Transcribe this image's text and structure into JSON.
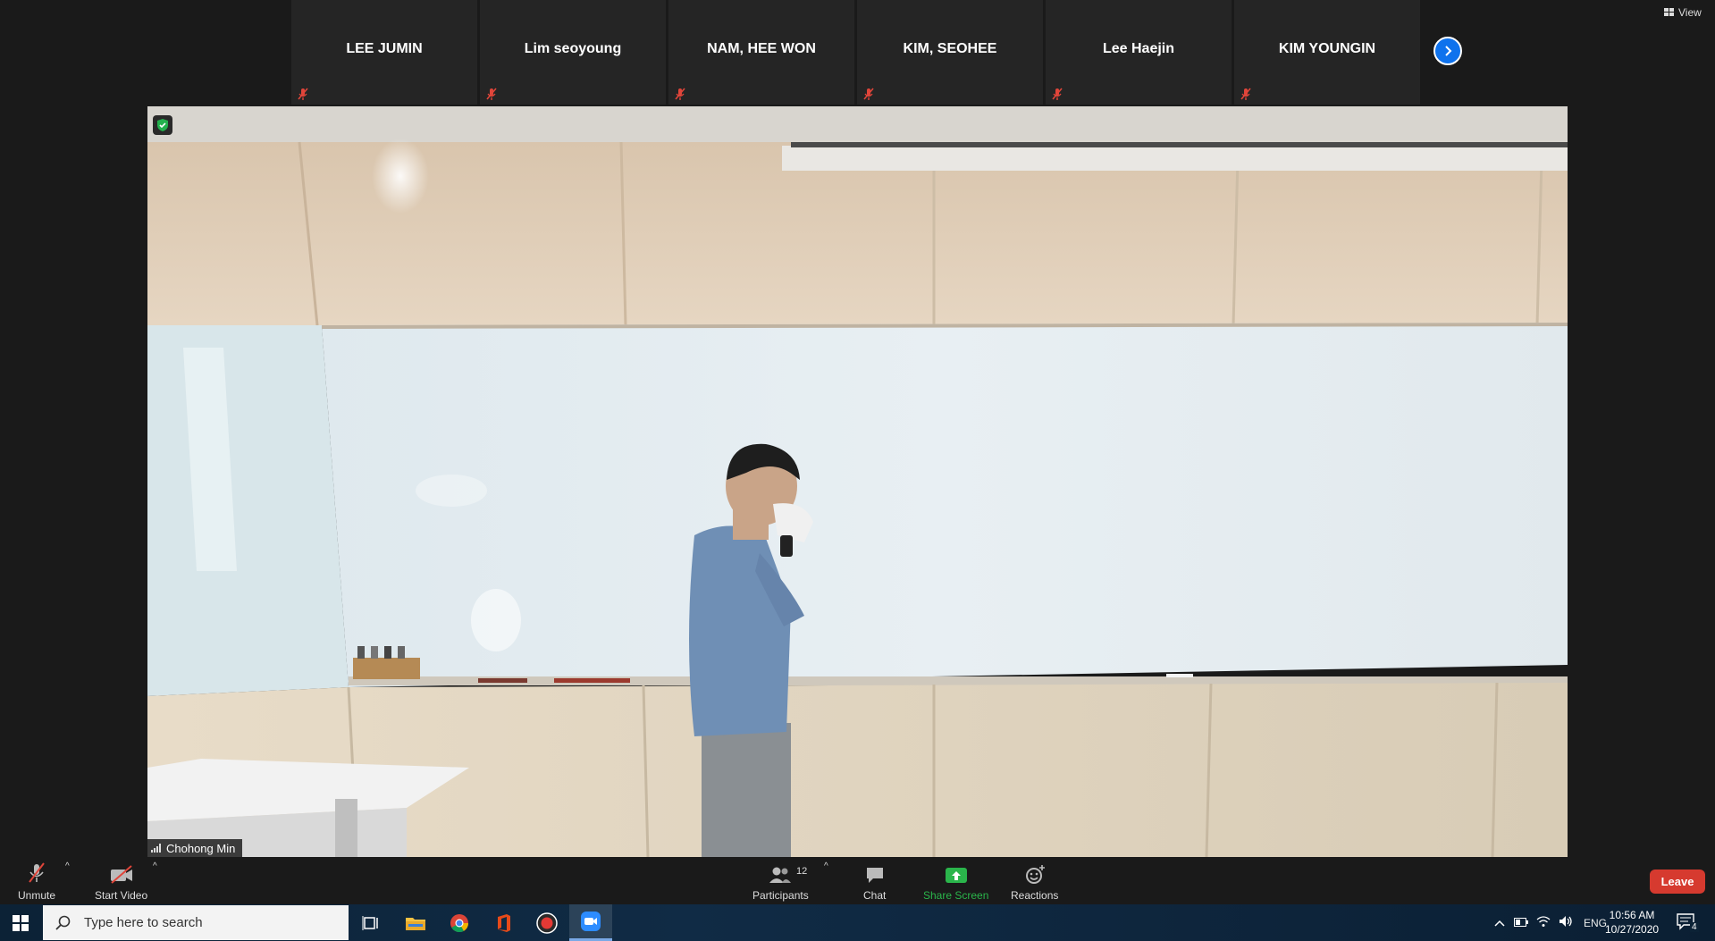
{
  "colors": {
    "background": "#1a1a1a",
    "tile": "#252525",
    "accent_blue": "#0e72ed",
    "share_green": "#2ab54b",
    "leave_red": "#d63a2f",
    "muted_red": "#e0453a"
  },
  "top_strip": {
    "participants": [
      {
        "name": "LEE JUMIN",
        "muted": true
      },
      {
        "name": "Lim seoyoung",
        "muted": true
      },
      {
        "name": "NAM, HEE WON",
        "muted": true
      },
      {
        "name": "KIM, SEOHEE",
        "muted": true
      },
      {
        "name": "Lee Haejin",
        "muted": true
      },
      {
        "name": "KIM YOUNGIN",
        "muted": true
      }
    ],
    "next_icon": "chevron-right-icon",
    "view_label": "View"
  },
  "main_video": {
    "speaker_name": "Chohong Min",
    "security_icon": "shield-check-icon"
  },
  "toolbar": {
    "unmute_label": "Unmute",
    "start_video_label": "Start Video",
    "participants_label": "Participants",
    "participants_count": "12",
    "chat_label": "Chat",
    "share_screen_label": "Share Screen",
    "reactions_label": "Reactions",
    "leave_label": "Leave"
  },
  "taskbar": {
    "search_placeholder": "Type here to search",
    "apps": [
      "task-view-icon",
      "file-explorer-icon",
      "chrome-icon",
      "office-icon",
      "recorder-icon",
      "zoom-icon"
    ],
    "language": "ENG",
    "time": "10:56 AM",
    "date": "10/27/2020",
    "notification_count": "4"
  }
}
